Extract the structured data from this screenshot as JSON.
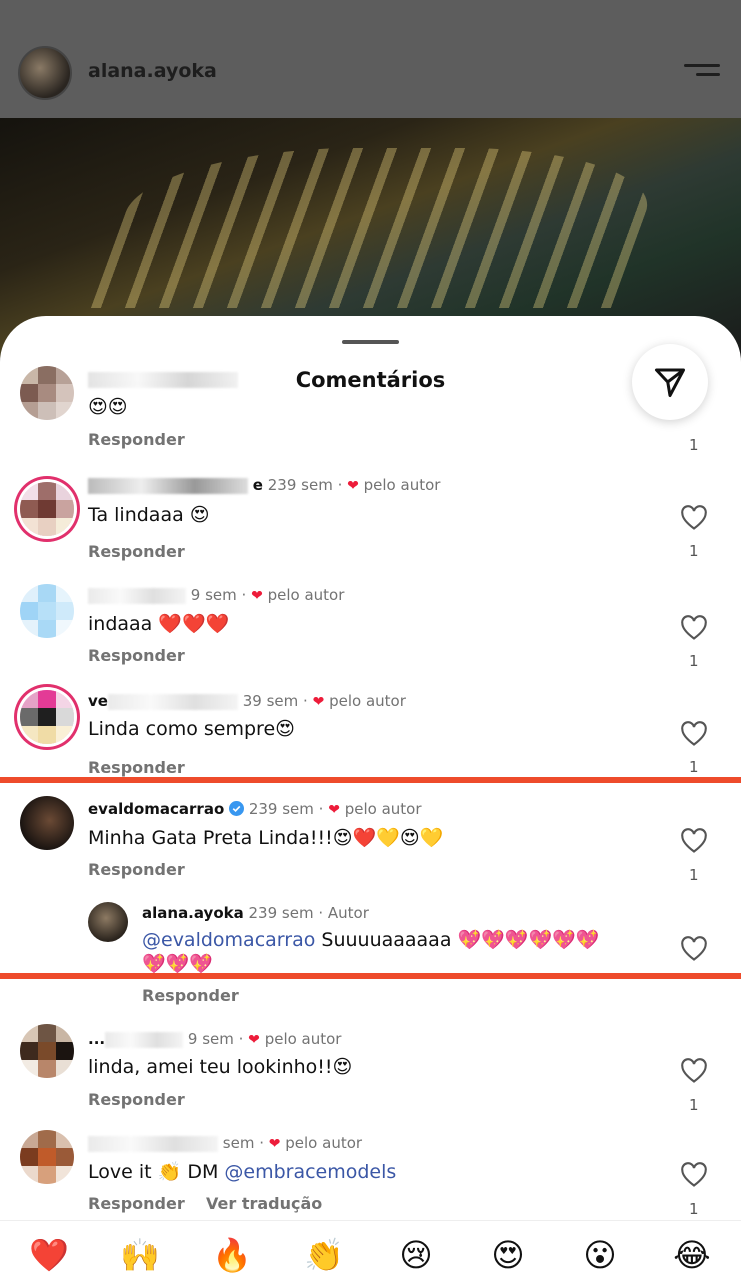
{
  "post": {
    "username": "alana.ayoka"
  },
  "sheet": {
    "title": "Comentários"
  },
  "comments": [
    {
      "time": "",
      "text": "😍😍",
      "reply": "Responder",
      "likes": "1"
    },
    {
      "user_suffix": "e",
      "time": "239 sem",
      "liked_by_author": "pelo autor",
      "text": "Ta lindaaa 😍",
      "reply": "Responder",
      "likes": "1"
    },
    {
      "time": "9 sem",
      "liked_by_author": "pelo autor",
      "text": "indaaa ❤️❤️❤️",
      "reply": "Responder",
      "likes": "1"
    },
    {
      "user_prefix": "ve",
      "time": "39 sem",
      "liked_by_author": "pelo autor",
      "text": "Linda como sempre😍",
      "reply": "Responder",
      "likes": "1"
    },
    {
      "user": "evaldomacarrao",
      "time": "239 sem",
      "liked_by_author": "pelo autor",
      "text": "Minha Gata Preta Linda!!!😍❤️💛😍💛",
      "reply": "Responder",
      "likes": "1"
    },
    {
      "user": "alana.ayoka",
      "time": "239 sem",
      "author_tag": "Autor",
      "mention": "@evaldomacarrao",
      "text_line1": " Suuuuaaaaaa 💖💖💖💖💖💖",
      "text_line2": "💖💖💖",
      "reply": "Responder"
    },
    {
      "user_prefix": "...",
      "time": "9 sem",
      "liked_by_author": "pelo autor",
      "text": "linda, amei teu lookinho!!😍",
      "reply": "Responder",
      "likes": "1"
    },
    {
      "time": "sem",
      "liked_by_author": "pelo autor",
      "text_prefix": "Love it 👏 DM ",
      "mention": "@embracemodels",
      "reply": "Responder",
      "translate": "Ver tradução",
      "likes": "1"
    }
  ],
  "emoji_bar": [
    "❤️",
    "🙌",
    "🔥",
    "👏",
    "😢",
    "😍",
    "😮",
    "😂"
  ],
  "colors": {
    "accent_red": "#ed1c3a",
    "mention_blue": "#3b57a6",
    "highlight_line": "#ee4b2b"
  }
}
